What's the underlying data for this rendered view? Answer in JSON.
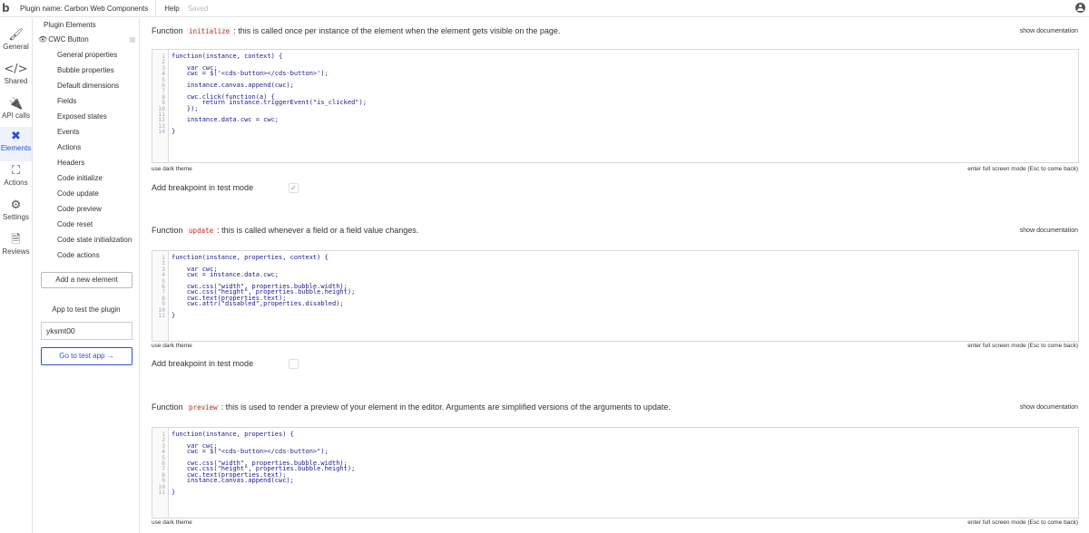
{
  "topbar": {
    "logo": "b",
    "plugin_name": "Plugin name: Carbon Web Components",
    "help": "Help",
    "saved": "Saved"
  },
  "nav": [
    {
      "label": "General",
      "icon": "brush-icon",
      "glyph": "🖌"
    },
    {
      "label": "Shared",
      "icon": "code-icon",
      "glyph": "</>"
    },
    {
      "label": "API calls",
      "icon": "plug-icon",
      "glyph": "🔌"
    },
    {
      "label": "Elements",
      "icon": "elements-icon",
      "glyph": "✖"
    },
    {
      "label": "Actions",
      "icon": "hierarchy-icon",
      "glyph": "⛶"
    },
    {
      "label": "Settings",
      "icon": "gear-icon",
      "glyph": "⚙"
    },
    {
      "label": "Reviews",
      "icon": "document-icon",
      "glyph": "🗎"
    }
  ],
  "plugin_panel": {
    "title": "Plugin Elements",
    "element_name": "CWC Button",
    "items": [
      "General properties",
      "Bubble properties",
      "Default dimensions",
      "Fields",
      "Exposed states",
      "Events",
      "Actions",
      "Headers",
      "Code initialize",
      "Code update",
      "Code preview",
      "Code reset",
      "Code state initialization",
      "Code actions"
    ],
    "add_new_element": "Add a new element",
    "app_to_test_label": "App to test the plugin",
    "app_to_test_value": "yksmt00",
    "go_to_test_app": "Go to test app →"
  },
  "sections": [
    {
      "prefix": "Function",
      "keyword": "initialize",
      "description": ": this is called once per instance of the element when the element gets visible on the page.",
      "show_documentation": "show documentation",
      "code": [
        "function(instance, context) {",
        "",
        "    var cwc;",
        "    cwc = $('<cds-button></cds-button>');",
        "",
        "    instance.canvas.append(cwc);",
        "",
        "    cwc.click(function(a) {",
        "        return instance.triggerEvent(\"is_clicked\");",
        "    });",
        "",
        "    instance.data.cwc = cwc;",
        "",
        "}"
      ],
      "dark_theme": "use dark theme",
      "full_screen": "enter full screen mode (Esc to come back)",
      "breakpoint_label": "Add breakpoint in test mode",
      "breakpoint_checked": true
    },
    {
      "prefix": "Function",
      "keyword": "update",
      "description": ": this is called whenever a field or a field value changes.",
      "show_documentation": "show documentation",
      "code": [
        "function(instance, properties, context) {",
        "",
        "    var cwc;",
        "    cwc = instance.data.cwc;",
        "",
        "    cwc.css(\"width\", properties.bubble.width);",
        "    cwc.css(\"height\", properties.bubble.height);",
        "    cwc.text(properties.text);",
        "    cwc.attr(\"disabled\",properties.disabled);",
        "",
        "}"
      ],
      "dark_theme": "use dark theme",
      "full_screen": "enter full screen mode (Esc to come back)",
      "breakpoint_label": "Add breakpoint in test mode",
      "breakpoint_checked": false
    },
    {
      "prefix": "Function",
      "keyword": "preview",
      "description": ": this is used to render a preview of your element in the editor. Arguments are simplified versions of the arguments to update.",
      "show_documentation": "show documentation",
      "code": [
        "function(instance, properties) {",
        "",
        "    var cwc;",
        "    cwc = $(\"<cds-button></cds-button>\");",
        "",
        "    cwc.css(\"width\", properties.bubble.width);",
        "    cwc.css(\"height\", properties.bubble.height);",
        "    cwc.text(properties.text);",
        "    instance.canvas.append(cwc);",
        "",
        "}"
      ],
      "dark_theme": "use dark theme",
      "full_screen": "enter full screen mode (Esc to come back)"
    }
  ]
}
